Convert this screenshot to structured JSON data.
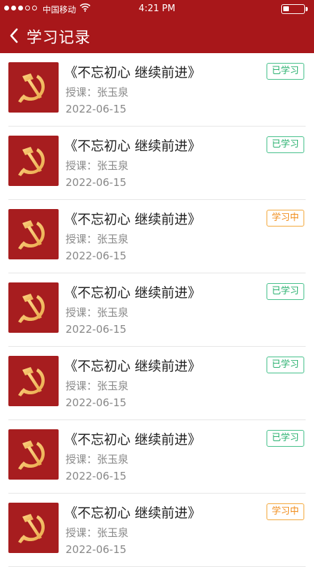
{
  "status_bar": {
    "carrier": "中国移动",
    "time": "4:21 PM"
  },
  "header": {
    "title": "学习记录"
  },
  "records": [
    {
      "title": "《不忘初心  继续前进》",
      "teacher": "授课：张玉泉",
      "date": "2022-06-15",
      "status": "已学习",
      "status_type": "done"
    },
    {
      "title": "《不忘初心  继续前进》",
      "teacher": "授课：张玉泉",
      "date": "2022-06-15",
      "status": "已学习",
      "status_type": "done"
    },
    {
      "title": "《不忘初心  继续前进》",
      "teacher": "授课：张玉泉",
      "date": "2022-06-15",
      "status": "学习中",
      "status_type": "studying"
    },
    {
      "title": "《不忘初心  继续前进》",
      "teacher": "授课：张玉泉",
      "date": "2022-06-15",
      "status": "已学习",
      "status_type": "done"
    },
    {
      "title": "《不忘初心  继续前进》",
      "teacher": "授课：张玉泉",
      "date": "2022-06-15",
      "status": "已学习",
      "status_type": "done"
    },
    {
      "title": "《不忘初心  继续前进》",
      "teacher": "授课：张玉泉",
      "date": "2022-06-15",
      "status": "已学习",
      "status_type": "done"
    },
    {
      "title": "《不忘初心  继续前进》",
      "teacher": "授课：张玉泉",
      "date": "2022-06-15",
      "status": "学习中",
      "status_type": "studying"
    }
  ],
  "colors": {
    "header": "#a8171a",
    "done": "#27b06e",
    "studying": "#f08c1a"
  },
  "icons": {
    "thumbnail": "hammer-sickle-icon",
    "back": "chevron-left-icon"
  }
}
